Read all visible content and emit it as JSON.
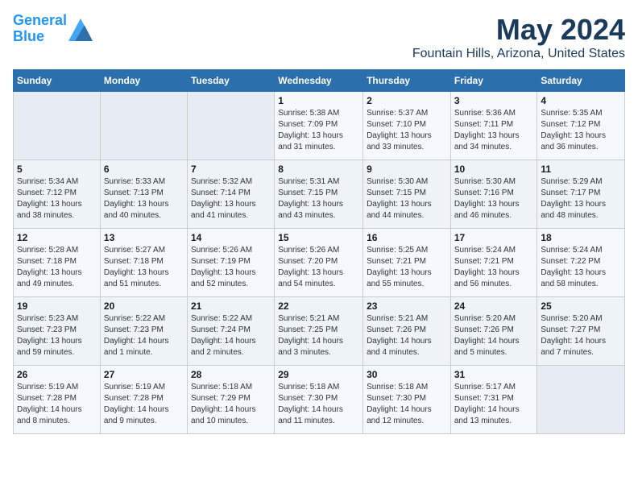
{
  "logo": {
    "line1": "General",
    "line2": "Blue"
  },
  "title": "May 2024",
  "subtitle": "Fountain Hills, Arizona, United States",
  "days_of_week": [
    "Sunday",
    "Monday",
    "Tuesday",
    "Wednesday",
    "Thursday",
    "Friday",
    "Saturday"
  ],
  "weeks": [
    [
      {
        "num": "",
        "info": ""
      },
      {
        "num": "",
        "info": ""
      },
      {
        "num": "",
        "info": ""
      },
      {
        "num": "1",
        "info": "Sunrise: 5:38 AM\nSunset: 7:09 PM\nDaylight: 13 hours\nand 31 minutes."
      },
      {
        "num": "2",
        "info": "Sunrise: 5:37 AM\nSunset: 7:10 PM\nDaylight: 13 hours\nand 33 minutes."
      },
      {
        "num": "3",
        "info": "Sunrise: 5:36 AM\nSunset: 7:11 PM\nDaylight: 13 hours\nand 34 minutes."
      },
      {
        "num": "4",
        "info": "Sunrise: 5:35 AM\nSunset: 7:12 PM\nDaylight: 13 hours\nand 36 minutes."
      }
    ],
    [
      {
        "num": "5",
        "info": "Sunrise: 5:34 AM\nSunset: 7:12 PM\nDaylight: 13 hours\nand 38 minutes."
      },
      {
        "num": "6",
        "info": "Sunrise: 5:33 AM\nSunset: 7:13 PM\nDaylight: 13 hours\nand 40 minutes."
      },
      {
        "num": "7",
        "info": "Sunrise: 5:32 AM\nSunset: 7:14 PM\nDaylight: 13 hours\nand 41 minutes."
      },
      {
        "num": "8",
        "info": "Sunrise: 5:31 AM\nSunset: 7:15 PM\nDaylight: 13 hours\nand 43 minutes."
      },
      {
        "num": "9",
        "info": "Sunrise: 5:30 AM\nSunset: 7:15 PM\nDaylight: 13 hours\nand 44 minutes."
      },
      {
        "num": "10",
        "info": "Sunrise: 5:30 AM\nSunset: 7:16 PM\nDaylight: 13 hours\nand 46 minutes."
      },
      {
        "num": "11",
        "info": "Sunrise: 5:29 AM\nSunset: 7:17 PM\nDaylight: 13 hours\nand 48 minutes."
      }
    ],
    [
      {
        "num": "12",
        "info": "Sunrise: 5:28 AM\nSunset: 7:18 PM\nDaylight: 13 hours\nand 49 minutes."
      },
      {
        "num": "13",
        "info": "Sunrise: 5:27 AM\nSunset: 7:18 PM\nDaylight: 13 hours\nand 51 minutes."
      },
      {
        "num": "14",
        "info": "Sunrise: 5:26 AM\nSunset: 7:19 PM\nDaylight: 13 hours\nand 52 minutes."
      },
      {
        "num": "15",
        "info": "Sunrise: 5:26 AM\nSunset: 7:20 PM\nDaylight: 13 hours\nand 54 minutes."
      },
      {
        "num": "16",
        "info": "Sunrise: 5:25 AM\nSunset: 7:21 PM\nDaylight: 13 hours\nand 55 minutes."
      },
      {
        "num": "17",
        "info": "Sunrise: 5:24 AM\nSunset: 7:21 PM\nDaylight: 13 hours\nand 56 minutes."
      },
      {
        "num": "18",
        "info": "Sunrise: 5:24 AM\nSunset: 7:22 PM\nDaylight: 13 hours\nand 58 minutes."
      }
    ],
    [
      {
        "num": "19",
        "info": "Sunrise: 5:23 AM\nSunset: 7:23 PM\nDaylight: 13 hours\nand 59 minutes."
      },
      {
        "num": "20",
        "info": "Sunrise: 5:22 AM\nSunset: 7:23 PM\nDaylight: 14 hours\nand 1 minute."
      },
      {
        "num": "21",
        "info": "Sunrise: 5:22 AM\nSunset: 7:24 PM\nDaylight: 14 hours\nand 2 minutes."
      },
      {
        "num": "22",
        "info": "Sunrise: 5:21 AM\nSunset: 7:25 PM\nDaylight: 14 hours\nand 3 minutes."
      },
      {
        "num": "23",
        "info": "Sunrise: 5:21 AM\nSunset: 7:26 PM\nDaylight: 14 hours\nand 4 minutes."
      },
      {
        "num": "24",
        "info": "Sunrise: 5:20 AM\nSunset: 7:26 PM\nDaylight: 14 hours\nand 5 minutes."
      },
      {
        "num": "25",
        "info": "Sunrise: 5:20 AM\nSunset: 7:27 PM\nDaylight: 14 hours\nand 7 minutes."
      }
    ],
    [
      {
        "num": "26",
        "info": "Sunrise: 5:19 AM\nSunset: 7:28 PM\nDaylight: 14 hours\nand 8 minutes."
      },
      {
        "num": "27",
        "info": "Sunrise: 5:19 AM\nSunset: 7:28 PM\nDaylight: 14 hours\nand 9 minutes."
      },
      {
        "num": "28",
        "info": "Sunrise: 5:18 AM\nSunset: 7:29 PM\nDaylight: 14 hours\nand 10 minutes."
      },
      {
        "num": "29",
        "info": "Sunrise: 5:18 AM\nSunset: 7:30 PM\nDaylight: 14 hours\nand 11 minutes."
      },
      {
        "num": "30",
        "info": "Sunrise: 5:18 AM\nSunset: 7:30 PM\nDaylight: 14 hours\nand 12 minutes."
      },
      {
        "num": "31",
        "info": "Sunrise: 5:17 AM\nSunset: 7:31 PM\nDaylight: 14 hours\nand 13 minutes."
      },
      {
        "num": "",
        "info": ""
      }
    ]
  ]
}
